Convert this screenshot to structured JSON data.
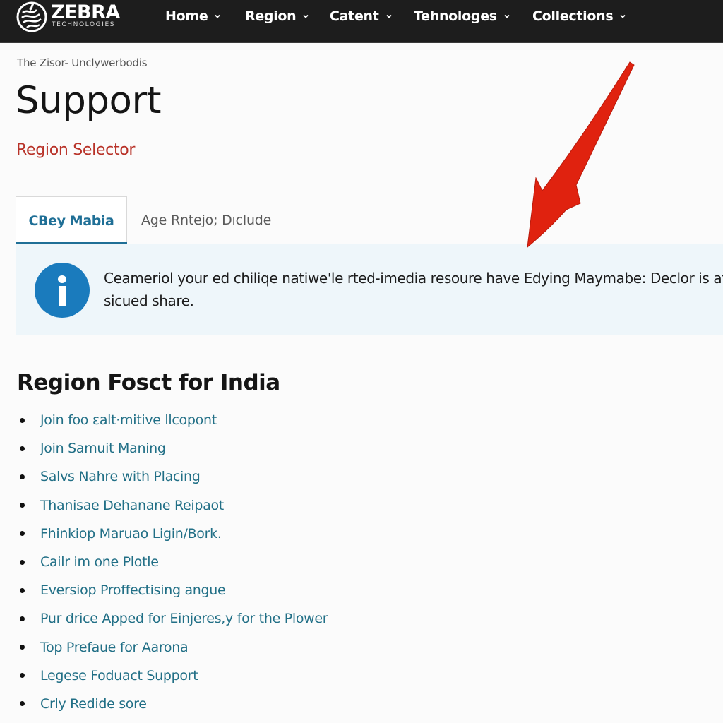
{
  "brand": {
    "name": "ZEBRA",
    "tagline": "TECHNOLOGIES",
    "logo_icon": "zebra-head-icon"
  },
  "nav": {
    "items": [
      {
        "label": "Home",
        "icon": "chevron-down-icon"
      },
      {
        "label": "Region",
        "icon": "chevron-down-icon"
      },
      {
        "label": "Catent",
        "icon": "chevron-down-icon"
      },
      {
        "label": "Tehnologes",
        "icon": "chevron-down-icon"
      },
      {
        "label": "Collections",
        "icon": "chevron-down-icon"
      }
    ]
  },
  "breadcrumb": "The Zisor- Unclywerbodis",
  "page": {
    "title": "Support",
    "subtitle": "Region Selector"
  },
  "tabs": [
    {
      "label": "CBey Mabia",
      "active": true
    },
    {
      "label": "Age Rntejo; Dıclude",
      "active": false
    }
  ],
  "info": {
    "icon": "info-icon",
    "line1": "Ceameriol your ed chiliqe natiwe'le rted-imedia resoure have Edying Maymabe: Declor is at",
    "line2": "sicued share."
  },
  "region_section": {
    "title": "Region Fosct for India",
    "links": [
      "Join foo ɛalt·mitive llcopont",
      "Join Samuit Maning",
      "Salvs Nahre with Placing",
      "Thanisae Dehanane Reipaot",
      "Fhinkiop Maruao Ligin/Bork.",
      "Cailr im one Plotle",
      "Eversiop Proffectising angue",
      "Pur drice Apped for Einjeres,y for the Plower",
      "Top Prefaue for Aarona",
      "Legese Foduact Support",
      "Crly Redide sore"
    ]
  },
  "annotation": {
    "icon": "red-arrow-icon",
    "color": "#e0220f"
  },
  "colors": {
    "nav_bg": "#1d1d1d",
    "accent_blue": "#1f6f96",
    "link_teal": "#216f86",
    "subtitle_red": "#b83228",
    "info_bg": "#eef6fa",
    "info_icon": "#1a7bbd"
  }
}
